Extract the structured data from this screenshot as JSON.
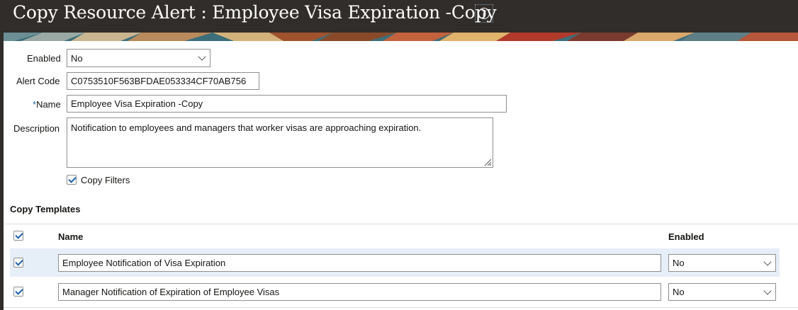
{
  "header": {
    "title": "Copy Resource Alert : Employee Visa Expiration -Copy",
    "help_glyph": "?"
  },
  "form": {
    "enabled": {
      "label": "Enabled",
      "value": "No"
    },
    "alert_code": {
      "label": "Alert Code",
      "value": "C0753510F563BFDAE053334CF70AB756"
    },
    "name": {
      "required_marker": "*",
      "label": "Name",
      "value": "Employee Visa Expiration -Copy"
    },
    "description": {
      "label": "Description",
      "value": "Notification to employees and managers that worker visas are approaching expiration."
    },
    "copy_filters": {
      "label": "Copy Filters",
      "checked": true
    }
  },
  "templates": {
    "section_title": "Copy Templates",
    "columns": {
      "name": "Name",
      "enabled": "Enabled"
    },
    "rows": [
      {
        "checked": true,
        "name": "Employee Notification of Visa Expiration",
        "enabled": "No",
        "selected": true
      },
      {
        "checked": true,
        "name": "Manager Notification of Expiration of Employee Visas",
        "enabled": "No",
        "selected": false
      }
    ]
  },
  "colors": {
    "title_bar": "#312d2a",
    "required": "#1f6bb8",
    "selected_row": "#e6eef8",
    "checkmark": "#1c5fa8"
  }
}
